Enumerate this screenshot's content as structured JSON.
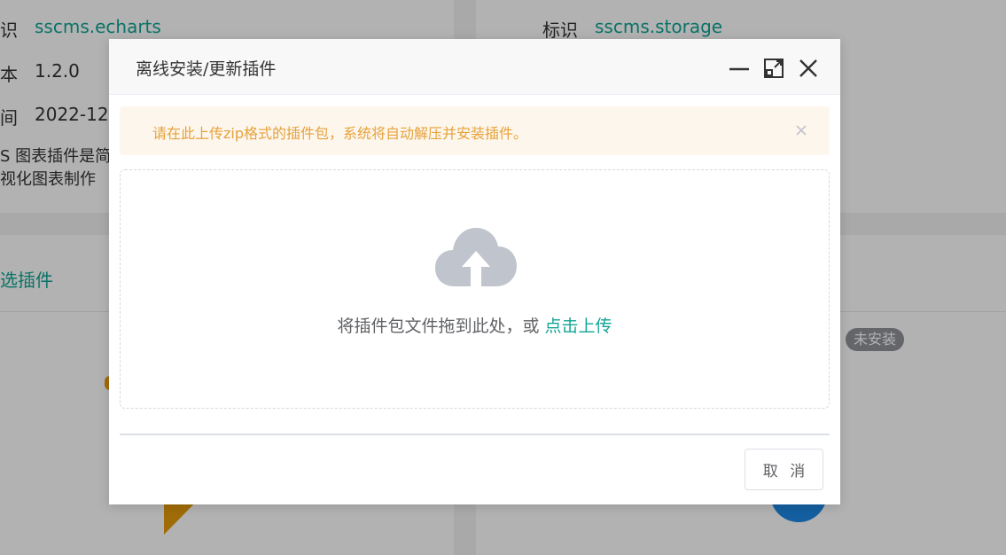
{
  "background": {
    "card_left": {
      "id_label": "识",
      "id_value": "sscms.echarts",
      "version_label": "本",
      "version_value": "1.2.0",
      "time_label": "间",
      "time_value": "2022-12",
      "desc_line1": "S 图表插件是简",
      "desc_line2": "视化图表制作"
    },
    "card_right": {
      "id_label": "标识",
      "id_value": "sscms.storage"
    },
    "select_plugin_link": "选插件",
    "status_tag": "未安装"
  },
  "dialog": {
    "title": "离线安装/更新插件",
    "alert_text": "请在此上传zip格式的插件包，系统将自动解压并安装插件。",
    "upload_hint": "将插件包文件拖到此处，或",
    "upload_link": "点击上传",
    "cancel_label": "取 消"
  },
  "colors": {
    "accent": "#11a596",
    "warning": "#e6a23c",
    "warning_bg": "#fdf6ec",
    "icon_gray": "#c0c4cc"
  }
}
